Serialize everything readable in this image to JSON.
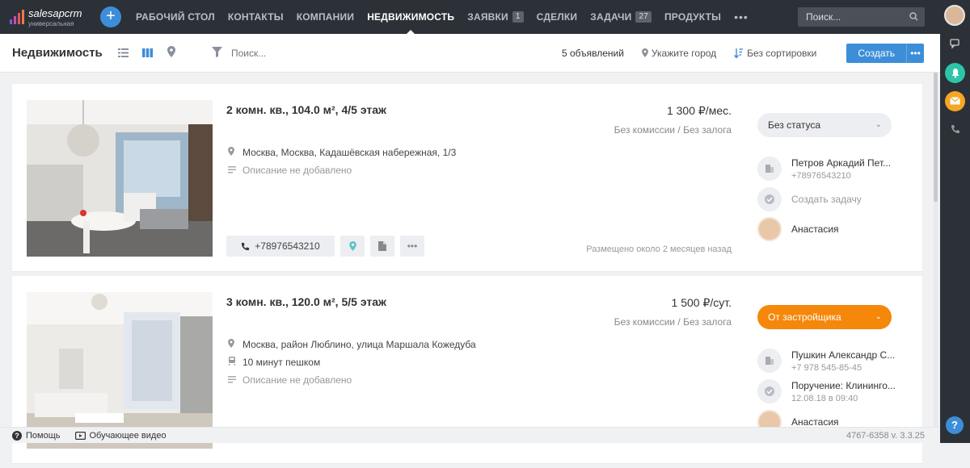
{
  "app": {
    "logo_name": "salesapcrm",
    "logo_sub": "универсальная"
  },
  "nav": [
    {
      "label": "РАБОЧИЙ СТОЛ",
      "badge": ""
    },
    {
      "label": "КОНТАКТЫ",
      "badge": ""
    },
    {
      "label": "КОМПАНИИ",
      "badge": ""
    },
    {
      "label": "НЕДВИЖИМОСТЬ",
      "badge": "",
      "active": true
    },
    {
      "label": "ЗАЯВКИ",
      "badge": "1"
    },
    {
      "label": "СДЕЛКИ",
      "badge": ""
    },
    {
      "label": "ЗАДАЧИ",
      "badge": "27"
    },
    {
      "label": "ПРОДУКТЫ",
      "badge": ""
    }
  ],
  "top_search": {
    "placeholder": "Поиск..."
  },
  "toolbar": {
    "title": "Недвижимость",
    "search_placeholder": "Поиск...",
    "count": "5 объявлений",
    "city": "Укажите город",
    "sort": "Без сортировки",
    "create": "Создать"
  },
  "listings": [
    {
      "title": "2 комн. кв., 104.0 м², 4/5 этаж",
      "price": "1 300 ₽/мес.",
      "commission": "Без комиссии / Без залога",
      "address": "Москва, Москва, Кадашёвская набережная, 1/3",
      "transport": "",
      "description": "Описание не добавлено",
      "phone": "+78976543210",
      "posted": "Размещено около 2 месяцев назад",
      "status": "Без статуса",
      "contact_name": "Петров Аркадий Пет...",
      "contact_phone": "+78976543210",
      "task": "Создать задачу",
      "task_date": "",
      "agent": "Анастасия"
    },
    {
      "title": "3 комн. кв., 120.0 м², 5/5 этаж",
      "price": "1 500 ₽/сут.",
      "commission": "Без комиссии / Без залога",
      "address": "Москва, район Люблино, улица Маршала Кожедуба",
      "transport": "10 минут пешком",
      "description": "Описание не добавлено",
      "phone": "",
      "posted": "",
      "status": "От застройщика",
      "contact_name": "Пушкин Александр С...",
      "contact_phone": "+7 978 545-85-45",
      "task": "Поручение: Клининго...",
      "task_date": "12.08.18 в 09:40",
      "agent": "Анастасия"
    }
  ],
  "footer": {
    "help": "Помощь",
    "video": "Обучающее видео",
    "version": "4767-6358  v. 3.3.25"
  },
  "colors": {
    "topbar": "#2c3138",
    "accent": "#3d8ed8",
    "status_orange": "#f5870b"
  }
}
